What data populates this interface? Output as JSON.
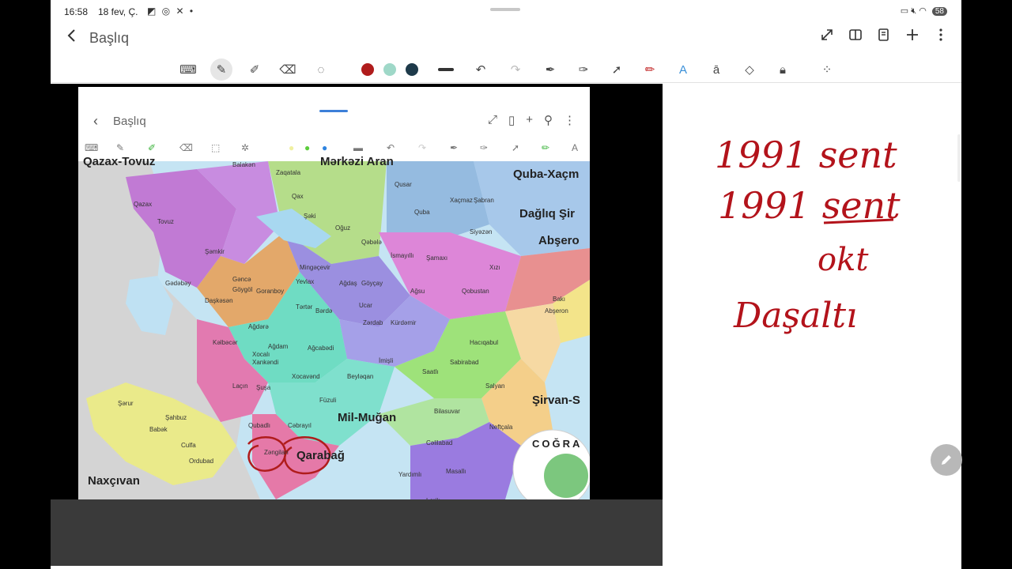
{
  "status": {
    "time": "16:58",
    "date": "18 fev, Ç.",
    "battery": "58"
  },
  "title_bar": {
    "back_icon": "chevron-left-icon",
    "title": "Başlıq"
  },
  "toolbar": {
    "colors": [
      "#b01c1c",
      "#9fd8c8",
      "#1e3a4a"
    ]
  },
  "inner_screenshot": {
    "title": "Başlıq",
    "map_labels": {
      "qazax_tovuz": "Qazax-Tovuz",
      "merkezi_aran": "Mərkəzi Aran",
      "quba_xacmaz": "Quba-Xaçm",
      "dagliq_sirvan": "Dağlıq Şir",
      "abseron": "Abşero",
      "sirvan_salyan": "Şirvan-S",
      "mil_mugan": "Mil-Muğan",
      "qarabag": "Qarabağ",
      "naxcivan": "Naxçıvan",
      "cografiya": "COĞRA"
    },
    "districts": [
      "Qazax",
      "Tovuz",
      "Şəmkir",
      "Gədəbəy",
      "Daşkəsən",
      "Gəncə",
      "Göygöl",
      "Goranboy",
      "Kəlbəcər",
      "Ağdərə",
      "Ağdam",
      "Ağcabədi",
      "Xocalı",
      "Xankəndi",
      "Laçın",
      "Şuşa",
      "Xocavənd",
      "Füzuli",
      "Qubadlı",
      "Cəbrayıl",
      "Zəngilan",
      "Beyləqan",
      "İmişli",
      "Saatlı",
      "Sabirabad",
      "Salyan",
      "Neftçala",
      "Bilasuvar",
      "Cəlilabad",
      "Masallı",
      "Yardımlı",
      "Lerik",
      "Bakı",
      "Abşeron",
      "Xızı",
      "Qobustan",
      "Şamaxı",
      "İsmayıllı",
      "Ağsu",
      "Kürdəmir",
      "Zərdab",
      "Ucar",
      "Göyçay",
      "Ağdaş",
      "Bərdə",
      "Tərtər",
      "Yevlax",
      "Mingəçevir",
      "Qəbələ",
      "Oğuz",
      "Şəki",
      "Qax",
      "Zaqatala",
      "Balakən",
      "Qusar",
      "Quba",
      "Xaçmaz",
      "Şabran",
      "Siyəzən",
      "Hacıqabul",
      "Şərur",
      "Babək",
      "Şahbuz",
      "Culfa",
      "Ordubad"
    ]
  },
  "handwriting": [
    "1991 sent",
    "1991 sent",
    "okt",
    "Daşaltı"
  ]
}
